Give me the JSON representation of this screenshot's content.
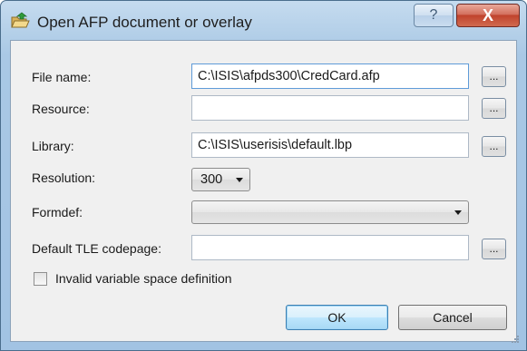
{
  "window": {
    "title": "Open AFP document or overlay",
    "help_glyph": "?",
    "close_glyph": "X"
  },
  "form": {
    "file_name": {
      "label": "File name:",
      "value": "C:\\ISIS\\afpds300\\CredCard.afp"
    },
    "resource": {
      "label": "Resource:",
      "value": ""
    },
    "library": {
      "label": "Library:",
      "value": "C:\\ISIS\\userisis\\default.lbp"
    },
    "resolution": {
      "label": "Resolution:",
      "value": "300"
    },
    "formdef": {
      "label": "Formdef:",
      "value": ""
    },
    "tle_codepage": {
      "label": "Default TLE codepage:",
      "value": ""
    },
    "browse_label": "...",
    "invalid_space": {
      "label": "Invalid variable space definition",
      "checked": false
    }
  },
  "buttons": {
    "ok": "OK",
    "cancel": "Cancel"
  },
  "colors": {
    "titlebar": "#b3cfe8",
    "close": "#c0432d",
    "client": "#f0f0f0",
    "default_button": "#bee6fd"
  },
  "icons": {
    "title": "folder-open-icon",
    "help": "help-icon",
    "close": "close-icon",
    "dropdown": "chevron-down-icon"
  }
}
